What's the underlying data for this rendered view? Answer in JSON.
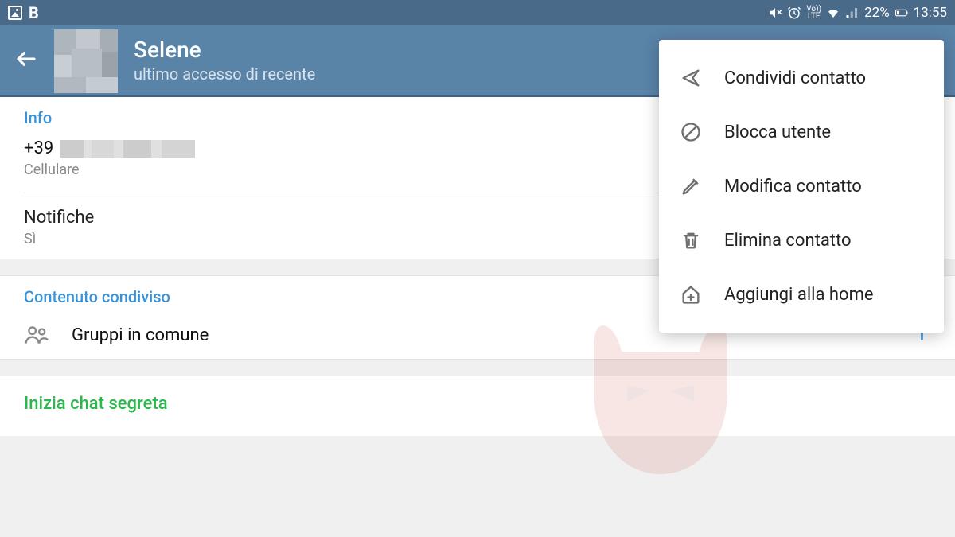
{
  "status_bar": {
    "left_app_indicator": "B",
    "battery_pct": "22%",
    "time": "13:55",
    "volte": "Vo))\nLTE",
    "icons": {
      "image": "image-icon",
      "mute": "mute-icon",
      "alarm": "alarm-icon",
      "volte": "volte-icon",
      "wifi": "wifi-icon",
      "signal": "signal-icon",
      "battery": "battery-icon"
    }
  },
  "header": {
    "name": "Selene",
    "last_seen": "ultimo accesso di recente"
  },
  "info_section": {
    "title": "Info",
    "phone_prefix": "+39",
    "phone_label": "Cellulare",
    "notifications_title": "Notifiche",
    "notifications_value": "Sì"
  },
  "shared_section": {
    "title": "Contenuto condiviso",
    "groups_label": "Gruppi in comune",
    "groups_count": "1"
  },
  "secret_chat": {
    "label": "Inizia chat segreta"
  },
  "menu": {
    "items": [
      {
        "icon": "share-icon",
        "label": "Condividi contatto"
      },
      {
        "icon": "block-icon",
        "label": "Blocca utente"
      },
      {
        "icon": "edit-icon",
        "label": "Modifica contatto"
      },
      {
        "icon": "delete-icon",
        "label": "Elimina contatto"
      },
      {
        "icon": "add-home-icon",
        "label": "Aggiungi alla home"
      }
    ]
  },
  "colors": {
    "status_bg": "#4a6a8a",
    "header_bg": "#5a83a8",
    "accent_blue": "#3a93d8",
    "accent_green": "#2db84d"
  }
}
